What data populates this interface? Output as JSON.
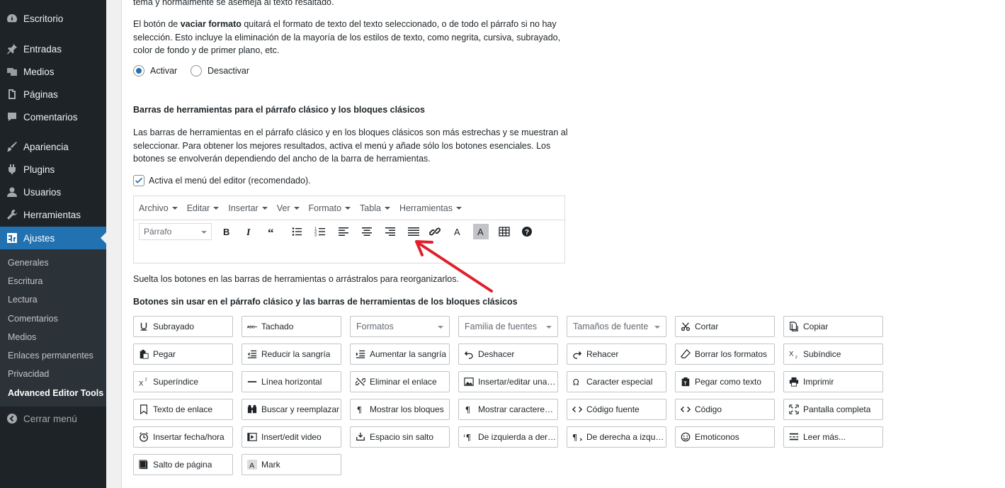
{
  "sidebar": {
    "items": [
      {
        "label": "Escritorio",
        "icon": "dashboard-icon"
      },
      {
        "label": "Entradas",
        "icon": "pin-icon"
      },
      {
        "label": "Medios",
        "icon": "media-icon"
      },
      {
        "label": "Páginas",
        "icon": "page-icon"
      },
      {
        "label": "Comentarios",
        "icon": "comment-icon"
      },
      {
        "label": "Apariencia",
        "icon": "brush-icon"
      },
      {
        "label": "Plugins",
        "icon": "plugin-icon"
      },
      {
        "label": "Usuarios",
        "icon": "user-icon"
      },
      {
        "label": "Herramientas",
        "icon": "wrench-icon"
      },
      {
        "label": "Ajustes",
        "icon": "settings-icon"
      }
    ],
    "submenu": [
      "Generales",
      "Escritura",
      "Lectura",
      "Comentarios",
      "Medios",
      "Enlaces permanentes",
      "Privacidad",
      "Advanced Editor Tools"
    ],
    "collapse_label": "Cerrar menú"
  },
  "content": {
    "top_line": "tema y normalmente se asemeja al texto resaltado.",
    "clear_pre": "El botón de ",
    "clear_bold": "vaciar formato",
    "clear_post": " quitará el formato de texto del texto seleccionado, o de todo el párrafo si no hay selección. Esto incluye la eliminación de la mayoría de los estilos de texto, como negrita, cursiva, subrayado, color de fondo y de primer plano, etc.",
    "radio_on": "Activar",
    "radio_off": "Desactivar",
    "toolbars_heading": "Barras de herramientas para el párrafo clásico y los bloques clásicos",
    "toolbars_desc": "Las barras de herramientas en el párrafo clásico y en los bloques clásicos son más estrechas y se muestran al seleccionar. Para obtener los mejores resultados, activa el menú y añade sólo los botones esenciales. Los botones se envolverán dependiendo del ancho de la barra de herramientas.",
    "checkbox_label": "Activa el menú del editor (recomendado).",
    "drop_hint": "Suelta los botones en las barras de herramientas o arrástralos para reorganizarlos.",
    "unused_heading": "Botones sin usar en el párrafo clásico y las barras de herramientas de los bloques clásicos"
  },
  "editor": {
    "menu": [
      "Archivo",
      "Editar",
      "Insertar",
      "Ver",
      "Formato",
      "Tabla",
      "Herramientas"
    ],
    "format_select": "Párrafo",
    "toolbar_icons": [
      "bold-icon",
      "italic-icon",
      "blockquote-icon",
      "bullet-list-icon",
      "numbered-list-icon",
      "align-left-icon",
      "align-center-icon",
      "align-right-icon",
      "align-justify-icon",
      "link-icon",
      "text-color-icon",
      "background-color-icon",
      "table-icon",
      "help-icon"
    ]
  },
  "unused_buttons": [
    [
      {
        "label": "Subrayado",
        "icon": "underline-icon"
      },
      {
        "label": "Tachado",
        "icon": "strikethrough-icon"
      },
      {
        "label": "Formatos",
        "select": true
      },
      {
        "label": "Familia de fuentes",
        "select": true
      },
      {
        "label": "Tamaños de fuente",
        "select": true
      },
      {
        "label": "Cortar",
        "icon": "cut-icon"
      },
      {
        "label": "Copiar",
        "icon": "copy-icon"
      }
    ],
    [
      {
        "label": "Pegar",
        "icon": "paste-icon"
      },
      {
        "label": "Reducir la sangría",
        "icon": "outdent-icon"
      },
      {
        "label": "Aumentar la sangría",
        "icon": "indent-icon"
      },
      {
        "label": "Deshacer",
        "icon": "undo-icon"
      },
      {
        "label": "Rehacer",
        "icon": "redo-icon"
      },
      {
        "label": "Borrar los formatos",
        "icon": "eraser-icon"
      },
      {
        "label": "Subíndice",
        "icon": "subscript-icon"
      }
    ],
    [
      {
        "label": "Superíndice",
        "icon": "superscript-icon"
      },
      {
        "label": "Línea horizontal",
        "icon": "horizontal-line-icon"
      },
      {
        "label": "Eliminar el enlace",
        "icon": "unlink-icon"
      },
      {
        "label": "Insertar/editar una i...",
        "icon": "image-icon"
      },
      {
        "label": "Caracter especial",
        "icon": "omega-icon"
      },
      {
        "label": "Pegar como texto",
        "icon": "paste-text-icon"
      },
      {
        "label": "Imprimir",
        "icon": "print-icon"
      }
    ],
    [
      {
        "label": "Texto de enlace",
        "icon": "bookmark-icon"
      },
      {
        "label": "Buscar y reemplazar",
        "icon": "binoculars-icon"
      },
      {
        "label": "Mostrar los bloques",
        "icon": "paragraph-icon"
      },
      {
        "label": "Mostrar caracteres i...",
        "icon": "paragraph-icon"
      },
      {
        "label": "Código fuente",
        "icon": "code-icon"
      },
      {
        "label": "Código",
        "icon": "code-icon"
      },
      {
        "label": "Pantalla completa",
        "icon": "fullscreen-icon"
      }
    ],
    [
      {
        "label": "Insertar fecha/hora",
        "icon": "clock-icon"
      },
      {
        "label": "Insert/edit video",
        "icon": "video-icon"
      },
      {
        "label": "Espacio sin salto",
        "icon": "nonbreaking-icon"
      },
      {
        "label": "De izquierda a dere...",
        "icon": "ltr-icon"
      },
      {
        "label": "De derecha a izquie...",
        "icon": "rtl-icon"
      },
      {
        "label": "Emoticonos",
        "icon": "smiley-icon"
      },
      {
        "label": "Leer más...",
        "icon": "read-more-icon"
      }
    ],
    [
      {
        "label": "Salto de página",
        "icon": "page-break-icon"
      },
      {
        "label": "Mark",
        "icon": "mark-icon"
      }
    ]
  ],
  "colors": {
    "sidebar_bg": "#1d2327",
    "accent": "#2271b1",
    "arrow": "#e0202c"
  }
}
